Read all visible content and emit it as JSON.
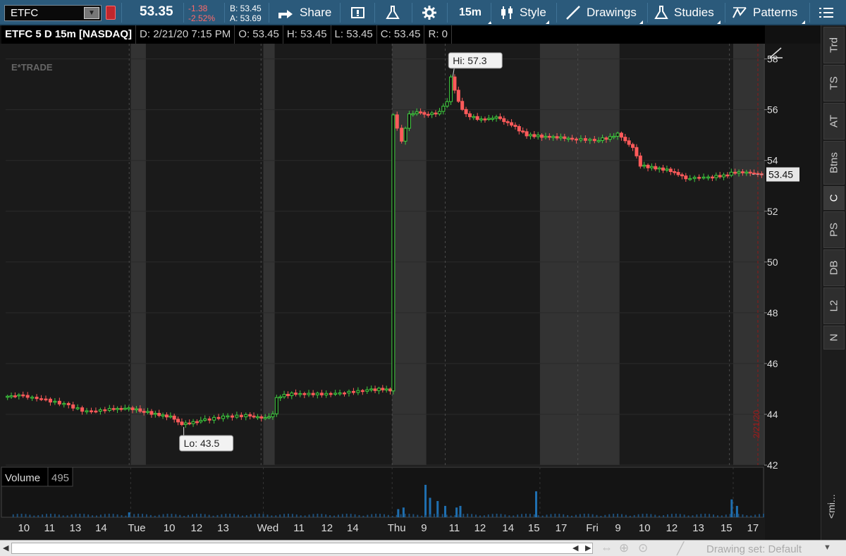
{
  "toolbar": {
    "symbol": "ETFC",
    "last_price": "53.35",
    "net_change": "-1.38",
    "pct_change": "-2.52%",
    "bid": "B: 53.45",
    "ask": "A: 53.69",
    "share_label": "Share",
    "timeframe_label": "15m",
    "style_label": "Style",
    "drawings_label": "Drawings",
    "studies_label": "Studies",
    "patterns_label": "Patterns"
  },
  "infobar": {
    "title": "ETFC 5 D 15m [NASDAQ]",
    "date": "D: 2/21/20 7:15 PM",
    "open": "O: 53.45",
    "high": "H: 53.45",
    "low": "L: 53.45",
    "close": "C: 53.45",
    "range": "R: 0"
  },
  "chart": {
    "watermark": "E*TRADE",
    "price_tag": "53.45",
    "hi_label": "Hi: 57.3",
    "lo_label": "Lo: 43.5",
    "expiry_marker": "2/21/20",
    "y_ticks": [
      "58",
      "56",
      "54",
      "52",
      "50",
      "48",
      "46",
      "44",
      "42"
    ],
    "x_ticks": [
      "10",
      "11",
      "13",
      "14",
      "Tue",
      "10",
      "12",
      "13",
      "Wed",
      "11",
      "12",
      "14",
      "Thu",
      "9",
      "11",
      "12",
      "14",
      "15",
      "17",
      "Fri",
      "9",
      "10",
      "12",
      "13",
      "15",
      "17"
    ],
    "volume_label": "Volume",
    "volume_value": "495",
    "volume_tick": "1",
    "collapse_label": "<mi..."
  },
  "chart_data": {
    "type": "candlestick",
    "title": "ETFC 5 D 15m [NASDAQ]",
    "ylim": [
      42,
      58.6
    ],
    "price_ticks": [
      42,
      44,
      46,
      48,
      50,
      52,
      54,
      56,
      58
    ],
    "high": 57.3,
    "low": 43.5,
    "last": 53.45,
    "close_path": [
      [
        0.0,
        44.7
      ],
      [
        0.02,
        44.75
      ],
      [
        0.05,
        44.6
      ],
      [
        0.08,
        44.4
      ],
      [
        0.11,
        44.1
      ],
      [
        0.14,
        44.2
      ],
      [
        0.165,
        44.25
      ],
      [
        0.18,
        44.15
      ],
      [
        0.2,
        44.0
      ],
      [
        0.22,
        43.9
      ],
      [
        0.235,
        43.6
      ],
      [
        0.26,
        43.75
      ],
      [
        0.29,
        43.9
      ],
      [
        0.32,
        43.95
      ],
      [
        0.345,
        43.85
      ],
      [
        0.355,
        44.0
      ],
      [
        0.36,
        44.7
      ],
      [
        0.38,
        44.8
      ],
      [
        0.42,
        44.8
      ],
      [
        0.45,
        44.85
      ],
      [
        0.48,
        44.95
      ],
      [
        0.5,
        45.0
      ],
      [
        0.51,
        44.95
      ],
      [
        0.513,
        55.8
      ],
      [
        0.52,
        55.3
      ],
      [
        0.525,
        54.8
      ],
      [
        0.535,
        55.8
      ],
      [
        0.545,
        55.9
      ],
      [
        0.56,
        55.8
      ],
      [
        0.575,
        55.9
      ],
      [
        0.58,
        56.1
      ],
      [
        0.585,
        56.3
      ],
      [
        0.59,
        57.3
      ],
      [
        0.6,
        56.3
      ],
      [
        0.61,
        55.8
      ],
      [
        0.63,
        55.6
      ],
      [
        0.65,
        55.7
      ],
      [
        0.67,
        55.4
      ],
      [
        0.69,
        55.0
      ],
      [
        0.71,
        54.95
      ],
      [
        0.735,
        54.9
      ],
      [
        0.75,
        54.85
      ],
      [
        0.78,
        54.8
      ],
      [
        0.8,
        54.9
      ],
      [
        0.81,
        55.05
      ],
      [
        0.83,
        54.5
      ],
      [
        0.84,
        53.8
      ],
      [
        0.86,
        53.7
      ],
      [
        0.88,
        53.6
      ],
      [
        0.9,
        53.3
      ],
      [
        0.93,
        53.35
      ],
      [
        0.95,
        53.4
      ],
      [
        0.96,
        53.5
      ],
      [
        0.975,
        53.55
      ],
      [
        1.0,
        53.45
      ]
    ],
    "volume_spikes": [
      [
        0.163,
        0.15
      ],
      [
        0.518,
        0.25
      ],
      [
        0.525,
        0.3
      ],
      [
        0.554,
        1.0
      ],
      [
        0.56,
        0.6
      ],
      [
        0.57,
        0.5
      ],
      [
        0.58,
        0.35
      ],
      [
        0.595,
        0.3
      ],
      [
        0.6,
        0.35
      ],
      [
        0.7,
        0.8
      ],
      [
        0.958,
        0.55
      ],
      [
        0.965,
        0.35
      ]
    ],
    "shaded_sessions": [
      [
        0.165,
        0.185
      ],
      [
        0.34,
        0.355
      ],
      [
        0.51,
        0.555
      ],
      [
        0.705,
        0.81
      ],
      [
        0.96,
        1.0
      ]
    ]
  }
}
